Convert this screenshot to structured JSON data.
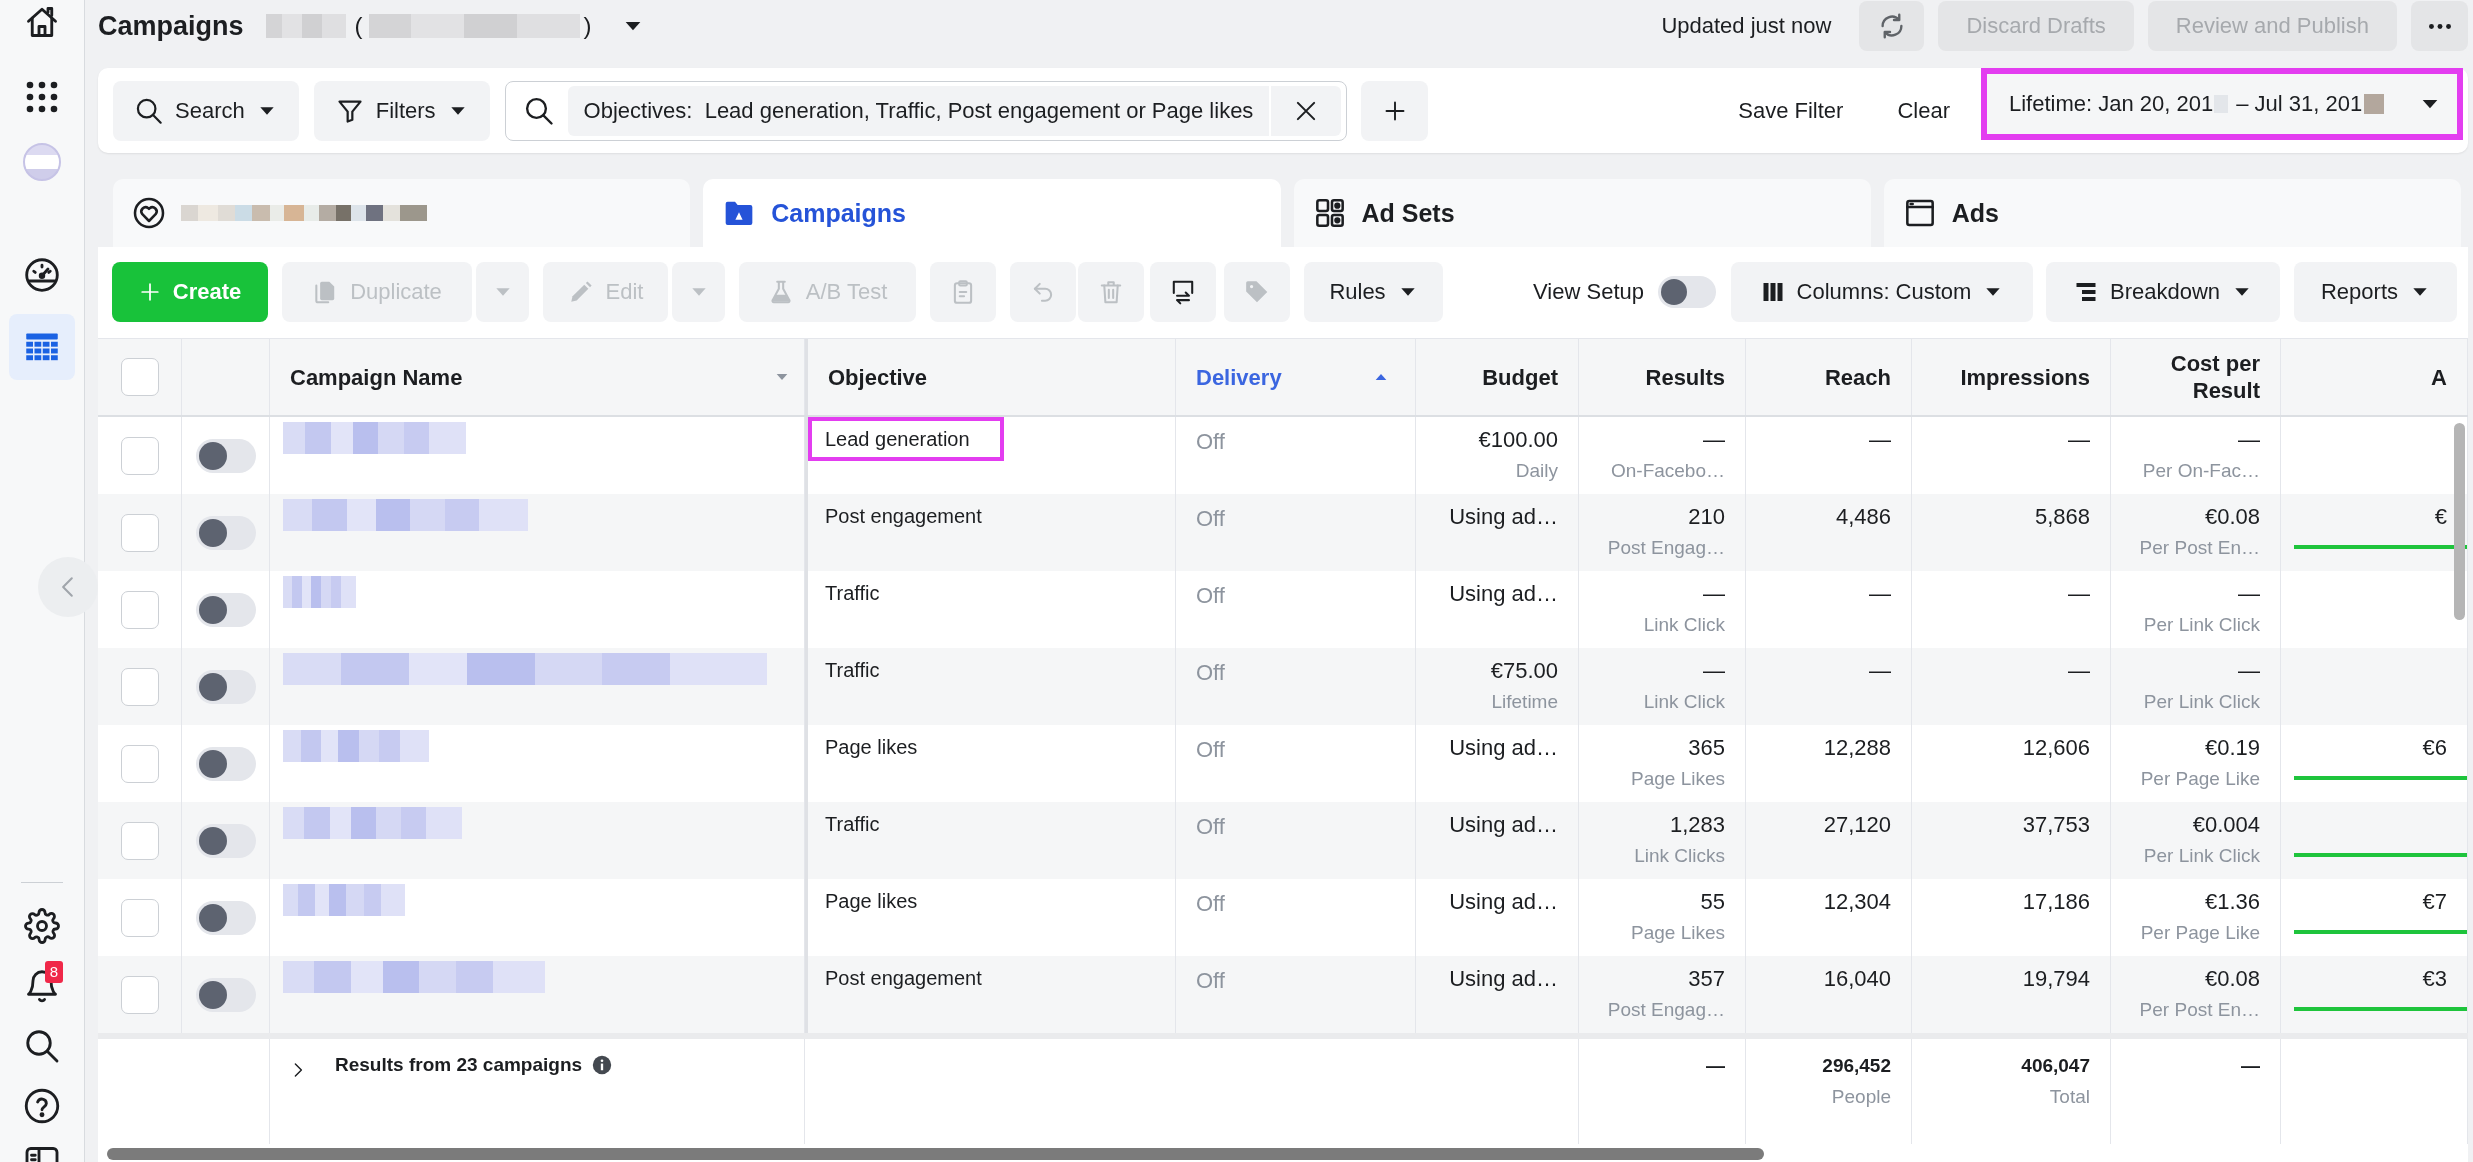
{
  "sidebar": {
    "items": [
      {
        "kind": "home",
        "selected": false
      },
      {
        "kind": "apps",
        "selected": false
      },
      {
        "kind": "account",
        "selected": false
      },
      {
        "kind": "dashboard",
        "selected": false
      },
      {
        "kind": "table",
        "selected": true
      }
    ],
    "bottom_items": [
      {
        "kind": "settings"
      },
      {
        "kind": "notifications",
        "badge": "8"
      },
      {
        "kind": "search"
      },
      {
        "kind": "help"
      },
      {
        "kind": "panel"
      }
    ]
  },
  "header": {
    "title": "Campaigns",
    "account_open": "(",
    "account_close": ")",
    "status": "Updated just now",
    "buttons": [
      {
        "kind": "refresh",
        "disabled": false
      },
      {
        "kind": "text",
        "label": "Discard Drafts",
        "disabled": true
      },
      {
        "kind": "text",
        "label": "Review and Publish",
        "disabled": true
      },
      {
        "kind": "more",
        "disabled": false
      }
    ]
  },
  "filter_bar": {
    "search_button": "Search",
    "filters_button": "Filters",
    "filter_chip": "Objectives:  Lead generation, Traffic, Post engagement or Page likes",
    "save_filter": "Save Filter",
    "clear": "Clear",
    "date_range": {
      "start": "Lifetime: Jan 20, 201",
      "end": "– Jul 31, 201",
      "highlighted": true
    }
  },
  "tabs": [
    {
      "kind": "account",
      "selected": false
    },
    {
      "kind": "campaigns",
      "label": "Campaigns",
      "selected": true
    },
    {
      "kind": "ad_sets",
      "label": "Ad Sets",
      "selected": false
    },
    {
      "kind": "ads",
      "label": "Ads",
      "selected": false
    }
  ],
  "toolbar": {
    "items": [
      {
        "kind": "create",
        "label": "Create",
        "disabled": false
      },
      {
        "kind": "duplicate",
        "label": "Duplicate",
        "disabled": true
      },
      {
        "kind": "caret",
        "disabled": true
      },
      {
        "kind": "edit",
        "label": "Edit",
        "disabled": true
      },
      {
        "kind": "caret",
        "disabled": true
      },
      {
        "kind": "ab_test",
        "label": "A/B Test",
        "disabled": true
      },
      {
        "kind": "clipboard",
        "disabled": true
      },
      {
        "kind": "undo",
        "disabled": true
      },
      {
        "kind": "trash",
        "disabled": true
      },
      {
        "kind": "swap",
        "disabled": false
      },
      {
        "kind": "tag",
        "disabled": true
      },
      {
        "kind": "rules",
        "label": "Rules",
        "disabled": false
      }
    ],
    "view_setup": {
      "label": "View Setup",
      "on": false
    },
    "right_items": [
      {
        "kind": "columns",
        "label": "Columns: Custom"
      },
      {
        "kind": "breakdown",
        "label": "Breakdown"
      },
      {
        "kind": "reports",
        "label": "Reports"
      }
    ]
  },
  "table": {
    "all_selected": false,
    "columns": [
      {
        "kind": "name",
        "label": "Campaign Name",
        "sorted": false
      },
      {
        "kind": "text",
        "label": "Objective",
        "sorted": false
      },
      {
        "kind": "text",
        "label": "Delivery",
        "sorted": true
      },
      {
        "kind": "number",
        "label": "Budget",
        "sorted": false
      },
      {
        "kind": "number",
        "label": "Results",
        "sorted": false
      },
      {
        "kind": "number",
        "label": "Reach",
        "sorted": false
      },
      {
        "kind": "number",
        "label": "Impressions",
        "sorted": false
      },
      {
        "kind": "number",
        "label": "Cost per Result",
        "sorted": false
      },
      {
        "kind": "number",
        "label": "A",
        "sorted": false
      }
    ],
    "rows": [
      {
        "selected": false,
        "on": false,
        "objective": "Lead generation",
        "highlighted": true,
        "delivery": "Off",
        "budget": "€100.00",
        "budget_note": "Daily",
        "results": "—",
        "results_note": "On-Facebo…",
        "reach": "—",
        "impressions": "—",
        "cost": "—",
        "cost_note": "Per On-Fac…",
        "bar_shown": false
      },
      {
        "selected": false,
        "on": false,
        "objective": "Post engagement",
        "highlighted": false,
        "delivery": "Off",
        "budget": "Using ad…",
        "results": "210",
        "results_note": "Post Engag…",
        "reach": "4,486",
        "impressions": "5,868",
        "cost": "€0.08",
        "cost_note": "Per Post En…",
        "column_9": "€",
        "bar_shown": true
      },
      {
        "selected": false,
        "on": false,
        "objective": "Traffic",
        "highlighted": false,
        "delivery": "Off",
        "budget": "Using ad…",
        "results": "—",
        "results_note": "Link Click",
        "reach": "—",
        "impressions": "—",
        "cost": "—",
        "cost_note": "Per Link Click",
        "bar_shown": false
      },
      {
        "selected": false,
        "on": false,
        "objective": "Traffic",
        "highlighted": false,
        "delivery": "Off",
        "budget": "€75.00",
        "budget_note": "Lifetime",
        "results": "—",
        "results_note": "Link Click",
        "reach": "—",
        "impressions": "—",
        "cost": "—",
        "cost_note": "Per Link Click",
        "bar_shown": false
      },
      {
        "selected": false,
        "on": false,
        "objective": "Page likes",
        "highlighted": false,
        "delivery": "Off",
        "budget": "Using ad…",
        "results": "365",
        "results_note": "Page Likes",
        "reach": "12,288",
        "impressions": "12,606",
        "cost": "€0.19",
        "cost_note": "Per Page Like",
        "column_9": "€6",
        "bar_shown": true
      },
      {
        "selected": false,
        "on": false,
        "objective": "Traffic",
        "highlighted": false,
        "delivery": "Off",
        "budget": "Using ad…",
        "results": "1,283",
        "results_note": "Link Clicks",
        "reach": "27,120",
        "impressions": "37,753",
        "cost": "€0.004",
        "cost_note": "Per Link Click",
        "bar_shown": true
      },
      {
        "selected": false,
        "on": false,
        "objective": "Page likes",
        "highlighted": false,
        "delivery": "Off",
        "budget": "Using ad…",
        "results": "55",
        "results_note": "Page Likes",
        "reach": "12,304",
        "impressions": "17,186",
        "cost": "€1.36",
        "cost_note": "Per Page Like",
        "column_9": "€7",
        "bar_shown": true
      },
      {
        "selected": false,
        "on": false,
        "objective": "Post engagement",
        "highlighted": false,
        "delivery": "Off",
        "budget": "Using ad…",
        "results": "357",
        "results_note": "Post Engag…",
        "reach": "16,040",
        "impressions": "19,794",
        "cost": "€0.08",
        "cost_note": "Per Post En…",
        "column_9": "€3",
        "bar_shown": true
      }
    ],
    "totals": {
      "label": "Results from 23 campaigns",
      "results": "—",
      "reach": "296,452",
      "reach_note": "People",
      "impressions": "406,047",
      "impressions_note": "Total",
      "cost": "—"
    }
  }
}
